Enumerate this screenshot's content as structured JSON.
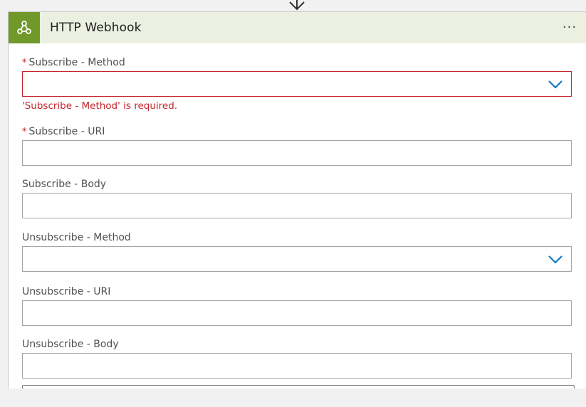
{
  "card": {
    "title": "HTTP Webhook",
    "icon": "webhook-icon",
    "more_label": "···",
    "accent_color": "#70982b",
    "header_bg": "#ebf0e0"
  },
  "fields": {
    "subscribe_method": {
      "label": "Subscribe - Method",
      "required_mark": "*",
      "value": "",
      "error": "'Subscribe - Method' is required."
    },
    "subscribe_uri": {
      "label": "Subscribe - URI",
      "required_mark": "*",
      "value": ""
    },
    "subscribe_body": {
      "label": "Subscribe - Body",
      "value": ""
    },
    "unsubscribe_method": {
      "label": "Unsubscribe - Method",
      "value": ""
    },
    "unsubscribe_uri": {
      "label": "Unsubscribe - URI",
      "value": ""
    },
    "unsubscribe_body": {
      "label": "Unsubscribe - Body",
      "value": ""
    }
  },
  "colors": {
    "error": "#c4262e",
    "chevron": "#0072c6"
  }
}
